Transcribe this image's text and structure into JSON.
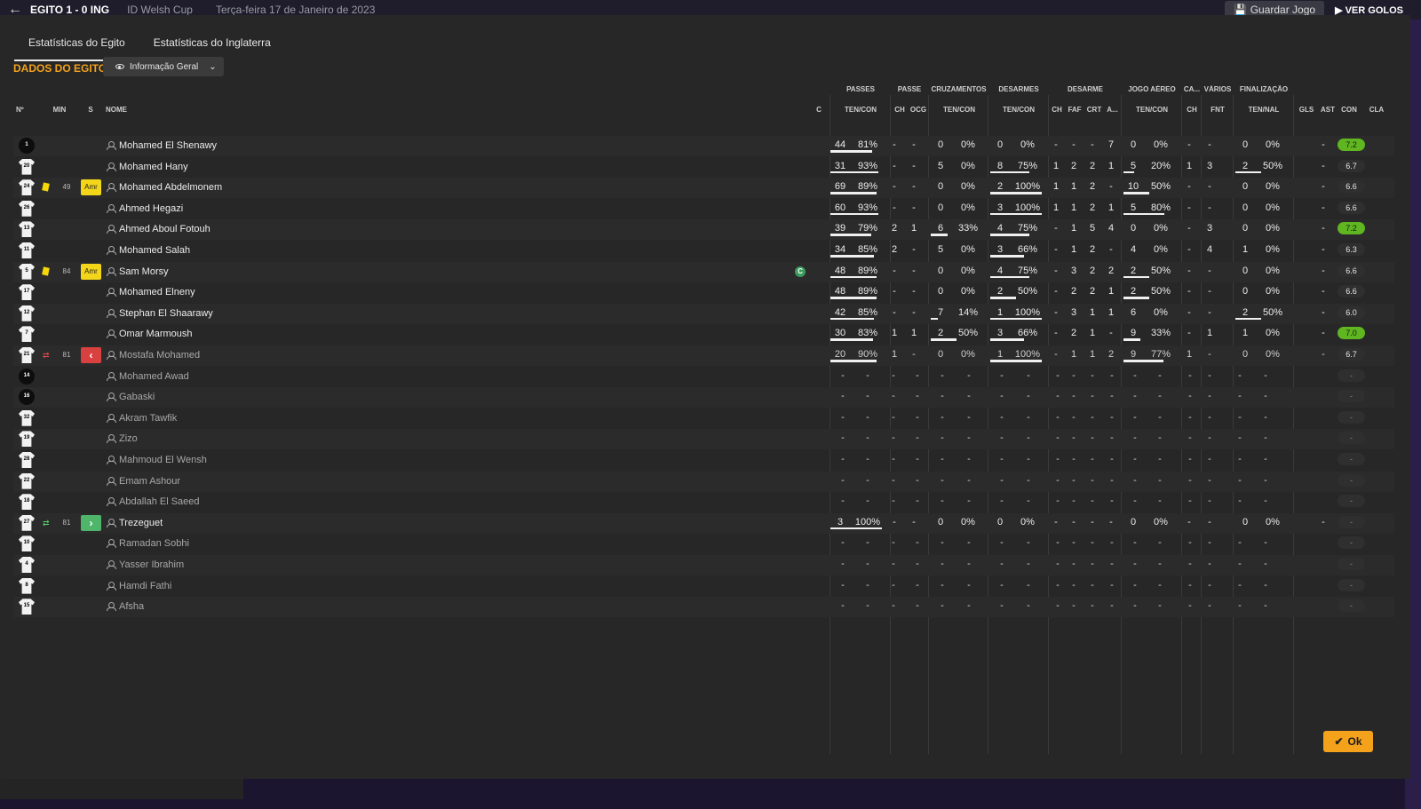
{
  "topbar": {
    "score": "EGITO  1 - 0  ING",
    "competition": "ID Welsh Cup",
    "date": "Terça-feira 17 de Janeiro de 2023",
    "save_label": "Guardar Jogo",
    "goals_label": "VER GOLOS"
  },
  "tabs": [
    "Estatísticas do Egito",
    "Estatísticas do Inglaterra"
  ],
  "section_title": "DADOS DO EGITO",
  "view_select": {
    "label": "Informação Geral"
  },
  "group_headers": {
    "passes": "PASSES",
    "passe": "PASSE",
    "cruzamentos": "CRUZAMENTOS",
    "desarmes": "DESARMES",
    "desarme": "DESARME",
    "jogo_aereo": "JOGO AÉREO",
    "ca": "CA...",
    "varios": "VÁRIOS",
    "finalizacao": "FINALIZAÇÃO"
  },
  "col_headers": {
    "no": "Nº",
    "min": "MIN",
    "s": "S",
    "nome": "NOME",
    "c": "C",
    "passes_tc": "TEN/CON",
    "passe_ch": "CH",
    "passe_ocg": "OCG",
    "cruz_tc": "TEN/CON",
    "des_tc": "TEN/CON",
    "d_ch": "CH",
    "d_faf": "FAF",
    "d_crt": "CRT",
    "d_a": "A...",
    "ja_tc": "TEN/CON",
    "ca_ch": "CH",
    "v_fnt": "FNT",
    "fin_tn": "TEN/NAL",
    "gls": "GLS",
    "ast": "AST",
    "con": "CON",
    "cla": "CLA"
  },
  "colors": {
    "accent": "#f3a21c",
    "rating_good": "#5fb620",
    "heart_green": "#3de07a",
    "heart_gold": "#e0a030"
  },
  "players": [
    {
      "no": "1",
      "shirt": "black",
      "card": "",
      "min": "",
      "badge": "",
      "name": "Mohamed El Shenawy",
      "cap": false,
      "inactive": false,
      "p": [
        "44",
        "81%"
      ],
      "pb": 0.81,
      "pch": "-",
      "pocg": "-",
      "cr": [
        "0",
        "0%"
      ],
      "crb": 0,
      "de": [
        "0",
        "0%"
      ],
      "deb": 0,
      "dch": "-",
      "dfaf": "-",
      "dcrt": "-",
      "da": "7",
      "ja": [
        "0",
        "0%"
      ],
      "jab": 0,
      "cach": "-",
      "fnt": "-",
      "fi": [
        "0",
        "0%"
      ],
      "fib": 0,
      "gls": "",
      "ast": "-",
      "con": "green",
      "cla": "7.2",
      "clag": true
    },
    {
      "no": "20",
      "shirt": "white",
      "card": "",
      "min": "",
      "badge": "",
      "name": "Mohamed Hany",
      "cap": false,
      "inactive": false,
      "p": [
        "31",
        "93%"
      ],
      "pb": 0.93,
      "pch": "-",
      "pocg": "-",
      "cr": [
        "5",
        "0%"
      ],
      "crb": 0,
      "de": [
        "8",
        "75%"
      ],
      "deb": 0.75,
      "dch": "1",
      "dfaf": "2",
      "dcrt": "2",
      "da": "1",
      "ja": [
        "5",
        "20%"
      ],
      "jab": 0.2,
      "cach": "1",
      "fnt": "3",
      "fi": [
        "2",
        "50%"
      ],
      "fib": 0.5,
      "gls": "",
      "ast": "-",
      "con": "gold",
      "cla": "6.7",
      "clag": false
    },
    {
      "no": "24",
      "shirt": "white",
      "card": "yellow",
      "min": "49",
      "badge": "amr",
      "name": "Mohamed Abdelmonem",
      "cap": false,
      "inactive": false,
      "p": [
        "69",
        "89%"
      ],
      "pb": 0.89,
      "pch": "-",
      "pocg": "-",
      "cr": [
        "0",
        "0%"
      ],
      "crb": 0,
      "de": [
        "2",
        "100%"
      ],
      "deb": 1,
      "dch": "1",
      "dfaf": "1",
      "dcrt": "2",
      "da": "-",
      "ja": [
        "10",
        "50%"
      ],
      "jab": 0.5,
      "cach": "-",
      "fnt": "-",
      "fi": [
        "0",
        "0%"
      ],
      "fib": 0,
      "gls": "",
      "ast": "-",
      "con": "gold",
      "cla": "6.6",
      "clag": false
    },
    {
      "no": "26",
      "shirt": "white",
      "card": "",
      "min": "",
      "badge": "",
      "name": "Ahmed Hegazi",
      "cap": false,
      "inactive": false,
      "p": [
        "60",
        "93%"
      ],
      "pb": 0.93,
      "pch": "-",
      "pocg": "-",
      "cr": [
        "0",
        "0%"
      ],
      "crb": 0,
      "de": [
        "3",
        "100%"
      ],
      "deb": 1,
      "dch": "1",
      "dfaf": "1",
      "dcrt": "2",
      "da": "1",
      "ja": [
        "5",
        "80%"
      ],
      "jab": 0.8,
      "cach": "-",
      "fnt": "-",
      "fi": [
        "0",
        "0%"
      ],
      "fib": 0,
      "gls": "",
      "ast": "-",
      "con": "gold",
      "cla": "6.6",
      "clag": false
    },
    {
      "no": "13",
      "shirt": "white",
      "card": "",
      "min": "",
      "badge": "",
      "name": "Ahmed Aboul Fotouh",
      "cap": false,
      "inactive": false,
      "p": [
        "39",
        "79%"
      ],
      "pb": 0.79,
      "pch": "2",
      "pocg": "1",
      "cr": [
        "6",
        "33%"
      ],
      "crb": 0.33,
      "de": [
        "4",
        "75%"
      ],
      "deb": 0.75,
      "dch": "-",
      "dfaf": "1",
      "dcrt": "5",
      "da": "4",
      "ja": [
        "0",
        "0%"
      ],
      "jab": 0,
      "cach": "-",
      "fnt": "3",
      "fi": [
        "0",
        "0%"
      ],
      "fib": 0,
      "gls": "",
      "ast": "-",
      "con": "gold",
      "cla": "7.2",
      "clag": true
    },
    {
      "no": "11",
      "shirt": "white",
      "card": "",
      "min": "",
      "badge": "",
      "name": "Mohamed Salah",
      "cap": false,
      "inactive": false,
      "p": [
        "34",
        "85%"
      ],
      "pb": 0.85,
      "pch": "2",
      "pocg": "-",
      "cr": [
        "5",
        "0%"
      ],
      "crb": 0,
      "de": [
        "3",
        "66%"
      ],
      "deb": 0.66,
      "dch": "-",
      "dfaf": "1",
      "dcrt": "2",
      "da": "-",
      "ja": [
        "4",
        "0%"
      ],
      "jab": 0,
      "cach": "-",
      "fnt": "4",
      "fi": [
        "1",
        "0%"
      ],
      "fib": 0,
      "gls": "",
      "ast": "-",
      "con": "gold",
      "cla": "6.3",
      "clag": false
    },
    {
      "no": "5",
      "shirt": "white",
      "card": "yellow",
      "min": "84",
      "badge": "amr",
      "name": "Sam Morsy",
      "cap": true,
      "inactive": false,
      "p": [
        "48",
        "89%"
      ],
      "pb": 0.89,
      "pch": "-",
      "pocg": "-",
      "cr": [
        "0",
        "0%"
      ],
      "crb": 0,
      "de": [
        "4",
        "75%"
      ],
      "deb": 0.75,
      "dch": "-",
      "dfaf": "3",
      "dcrt": "2",
      "da": "2",
      "ja": [
        "2",
        "50%"
      ],
      "jab": 0.5,
      "cach": "-",
      "fnt": "-",
      "fi": [
        "0",
        "0%"
      ],
      "fib": 0,
      "gls": "",
      "ast": "-",
      "con": "gold",
      "cla": "6.6",
      "clag": false
    },
    {
      "no": "17",
      "shirt": "white",
      "card": "",
      "min": "",
      "badge": "",
      "name": "Mohamed Elneny",
      "cap": false,
      "inactive": false,
      "p": [
        "48",
        "89%"
      ],
      "pb": 0.89,
      "pch": "-",
      "pocg": "-",
      "cr": [
        "0",
        "0%"
      ],
      "crb": 0,
      "de": [
        "2",
        "50%"
      ],
      "deb": 0.5,
      "dch": "-",
      "dfaf": "2",
      "dcrt": "2",
      "da": "1",
      "ja": [
        "2",
        "50%"
      ],
      "jab": 0.5,
      "cach": "-",
      "fnt": "-",
      "fi": [
        "0",
        "0%"
      ],
      "fib": 0,
      "gls": "",
      "ast": "-",
      "con": "gold",
      "cla": "6.6",
      "clag": false
    },
    {
      "no": "12",
      "shirt": "white",
      "card": "",
      "min": "",
      "badge": "",
      "name": "Stephan El Shaarawy",
      "cap": false,
      "inactive": false,
      "p": [
        "42",
        "85%"
      ],
      "pb": 0.85,
      "pch": "-",
      "pocg": "-",
      "cr": [
        "7",
        "14%"
      ],
      "crb": 0.14,
      "de": [
        "1",
        "100%"
      ],
      "deb": 1,
      "dch": "-",
      "dfaf": "3",
      "dcrt": "1",
      "da": "1",
      "ja": [
        "6",
        "0%"
      ],
      "jab": 0,
      "cach": "-",
      "fnt": "-",
      "fi": [
        "2",
        "50%"
      ],
      "fib": 0.5,
      "gls": "",
      "ast": "-",
      "con": "gold",
      "cla": "6.0",
      "clag": false
    },
    {
      "no": "7",
      "shirt": "white",
      "card": "",
      "min": "",
      "badge": "",
      "name": "Omar Marmoush",
      "cap": false,
      "inactive": false,
      "p": [
        "30",
        "83%"
      ],
      "pb": 0.83,
      "pch": "1",
      "pocg": "1",
      "cr": [
        "2",
        "50%"
      ],
      "crb": 0.5,
      "de": [
        "3",
        "66%"
      ],
      "deb": 0.66,
      "dch": "-",
      "dfaf": "2",
      "dcrt": "1",
      "da": "-",
      "ja": [
        "9",
        "33%"
      ],
      "jab": 0.33,
      "cach": "-",
      "fnt": "1",
      "fi": [
        "1",
        "0%"
      ],
      "fib": 0,
      "gls": "",
      "ast": "-",
      "con": "gold",
      "cla": "7.0",
      "clag": true
    },
    {
      "no": "21",
      "shirt": "white",
      "card": "out",
      "min": "81",
      "badge": "out",
      "name": "Mostafa Mohamed",
      "cap": false,
      "inactive": true,
      "p": [
        "20",
        "90%"
      ],
      "pb": 0.9,
      "pch": "1",
      "pocg": "-",
      "cr": [
        "0",
        "0%"
      ],
      "crb": 0,
      "de": [
        "1",
        "100%"
      ],
      "deb": 1,
      "dch": "-",
      "dfaf": "1",
      "dcrt": "1",
      "da": "2",
      "ja": [
        "9",
        "77%"
      ],
      "jab": 0.77,
      "cach": "1",
      "fnt": "-",
      "fi": [
        "0",
        "0%"
      ],
      "fib": 0,
      "gls": "",
      "ast": "-",
      "con": "gold",
      "cla": "6.7",
      "clag": false
    },
    {
      "no": "14",
      "shirt": "black",
      "card": "",
      "min": "",
      "badge": "",
      "name": "Mohamed Awad",
      "cap": false,
      "inactive": true,
      "empty": true,
      "con": "green",
      "cla": "-",
      "clag": false
    },
    {
      "no": "16",
      "shirt": "black",
      "card": "",
      "min": "",
      "badge": "",
      "name": "Gabaski",
      "cap": false,
      "inactive": true,
      "empty": true,
      "con": "green",
      "cla": "-",
      "clag": false
    },
    {
      "no": "32",
      "shirt": "white",
      "card": "",
      "min": "",
      "badge": "",
      "name": "Akram Tawfik",
      "cap": false,
      "inactive": true,
      "empty": true,
      "con": "green",
      "cla": "-",
      "clag": false
    },
    {
      "no": "19",
      "shirt": "white",
      "card": "",
      "min": "",
      "badge": "",
      "name": "Zizo",
      "cap": false,
      "inactive": true,
      "empty": true,
      "con": "green",
      "cla": "-",
      "clag": false
    },
    {
      "no": "28",
      "shirt": "white",
      "card": "",
      "min": "",
      "badge": "",
      "name": "Mahmoud El Wensh",
      "cap": false,
      "inactive": true,
      "empty": true,
      "con": "green",
      "cla": "-",
      "clag": false
    },
    {
      "no": "22",
      "shirt": "white",
      "card": "",
      "min": "",
      "badge": "",
      "name": "Emam Ashour",
      "cap": false,
      "inactive": true,
      "empty": true,
      "con": "green",
      "cla": "-",
      "clag": false
    },
    {
      "no": "18",
      "shirt": "white",
      "card": "",
      "min": "",
      "badge": "",
      "name": "Abdallah El Saeed",
      "cap": false,
      "inactive": true,
      "empty": true,
      "con": "green",
      "cla": "-",
      "clag": false
    },
    {
      "no": "27",
      "shirt": "white",
      "card": "in",
      "min": "81",
      "badge": "in",
      "name": "Trezeguet",
      "cap": false,
      "inactive": false,
      "p": [
        "3",
        "100%"
      ],
      "pb": 1,
      "pch": "-",
      "pocg": "-",
      "cr": [
        "0",
        "0%"
      ],
      "crb": 0,
      "de": [
        "0",
        "0%"
      ],
      "deb": 0,
      "dch": "-",
      "dfaf": "-",
      "dcrt": "-",
      "da": "-",
      "ja": [
        "0",
        "0%"
      ],
      "jab": 0,
      "cach": "-",
      "fnt": "-",
      "fi": [
        "0",
        "0%"
      ],
      "fib": 0,
      "gls": "",
      "ast": "-",
      "con": "green",
      "cla": "-",
      "clag": false
    },
    {
      "no": "10",
      "shirt": "white",
      "card": "",
      "min": "",
      "badge": "",
      "name": "Ramadan Sobhi",
      "cap": false,
      "inactive": true,
      "empty": true,
      "con": "green",
      "cla": "-",
      "clag": false
    },
    {
      "no": "4",
      "shirt": "white",
      "card": "",
      "min": "",
      "badge": "",
      "name": "Yasser Ibrahim",
      "cap": false,
      "inactive": true,
      "empty": true,
      "con": "green",
      "cla": "-",
      "clag": false
    },
    {
      "no": "8",
      "shirt": "white",
      "card": "",
      "min": "",
      "badge": "",
      "name": "Hamdi Fathi",
      "cap": false,
      "inactive": true,
      "empty": true,
      "con": "green",
      "cla": "-",
      "clag": false
    },
    {
      "no": "15",
      "shirt": "white",
      "card": "",
      "min": "",
      "badge": "",
      "name": "Afsha",
      "cap": false,
      "inactive": true,
      "empty": true,
      "con": "green",
      "cla": "-",
      "clag": false
    }
  ],
  "ok_label": "Ok",
  "amr_label": "Amr",
  "captain_label": "C"
}
